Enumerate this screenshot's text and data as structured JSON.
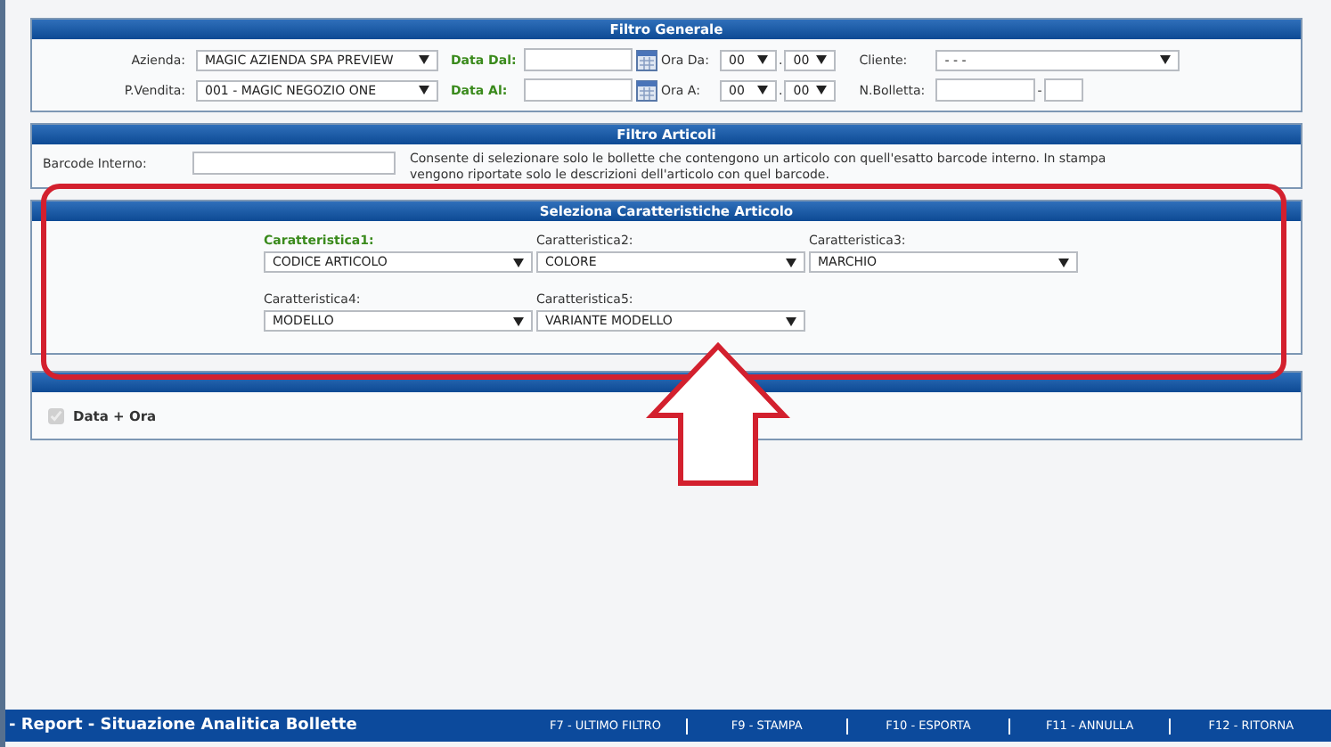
{
  "filtro_generale": {
    "title": "Filtro Generale",
    "rows": [
      {
        "label": "Azienda:",
        "value": "MAGIC AZIENDA SPA PREVIEW",
        "date_label": "Data Dal:",
        "time_label": "Ora Da:",
        "hour": "00",
        "time_separator": ".",
        "minute": "00",
        "extra_label": "Cliente:",
        "extra_value": "- - -"
      },
      {
        "label": "P.Vendita:",
        "value": "001 - MAGIC NEGOZIO ONE",
        "date_label": "Data Al:",
        "time_label": "Ora A:",
        "hour": "00",
        "time_separator": ".",
        "minute": "00",
        "extra_label": "N.Bolletta:",
        "separator": "-"
      }
    ]
  },
  "filtro_articoli": {
    "title": "Filtro Articoli",
    "label": "Barcode Interno:",
    "note": "Consente di selezionare solo le bollette che contengono un articolo con quell'esatto barcode interno. In stampa vengono riportate solo le descrizioni dell'articolo con quel barcode."
  },
  "caratteristiche": {
    "title": "Seleziona Caratteristiche Articolo",
    "items": [
      {
        "label": "Caratteristica1:",
        "value": "CODICE ARTICOLO",
        "highlighted": true
      },
      {
        "label": "Caratteristica2:",
        "value": "COLORE",
        "highlighted": false
      },
      {
        "label": "Caratteristica3:",
        "value": "MARCHIO",
        "highlighted": false
      },
      {
        "label": "Caratteristica4:",
        "value": "MODELLO",
        "highlighted": false
      },
      {
        "label": "Caratteristica5:",
        "value": "VARIANTE MODELLO",
        "highlighted": false
      }
    ]
  },
  "ordinamento": {
    "options": [
      {
        "label": "Data + Ora",
        "checked": true,
        "disabled": true
      }
    ]
  },
  "footer": {
    "title": "- Report - Situazione Analitica Bollette",
    "keys": [
      "F7 - ULTIMO FILTRO",
      "F9 - STAMPA",
      "F10 - ESPORTA",
      "F11 - ANNULLA",
      "F12 - RITORNA"
    ]
  }
}
